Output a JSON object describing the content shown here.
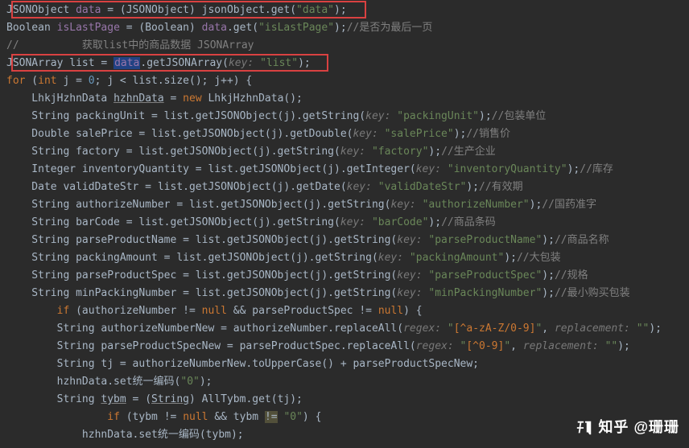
{
  "lines": {
    "l1": {
      "p1": "JSONObject ",
      "p2": "data",
      "p3": " = (JSONObject) jsonObject.get(",
      "p4": "\"data\"",
      "p5": ");"
    },
    "l2": {
      "p1": "Boolean ",
      "p2": "isLastPage",
      "p3": " = (Boolean) ",
      "p4": "data",
      "p5": ".get(",
      "p6": "\"isLastPage\"",
      "p7": ");",
      "p8": "//是否为最后一页"
    },
    "l3": {
      "p1": "//          获取list中的商品数据 JSONArray"
    },
    "l4": {
      "p1": "JSONArray list = ",
      "p2": "data",
      "p3": ".getJSONArray(",
      "p4": "key: ",
      "p5": "\"list\"",
      "p6": ");"
    },
    "l5": {
      "p1": "for",
      "p2": " (",
      "p3": "int",
      "p4": " j = ",
      "p5": "0",
      "p6": "; j < list.size(); j++) {"
    },
    "l6": {
      "p1": "    LhkjHzhnData ",
      "p2": "hzhnData",
      "p3": " = ",
      "p4": "new",
      "p5": " LhkjHzhnData();"
    },
    "l7": {
      "p1": "    String packingUnit = list.getJSONObject(j).getString(",
      "p2": "key: ",
      "p3": "\"packingUnit\"",
      "p4": ");",
      "p5": "//包装单位"
    },
    "l8": {
      "p1": "    Double salePrice = list.getJSONObject(j).getDouble(",
      "p2": "key: ",
      "p3": "\"salePrice\"",
      "p4": ");",
      "p5": "//销售价"
    },
    "l9": {
      "p1": "    String factory = list.getJSONObject(j).getString(",
      "p2": "key: ",
      "p3": "\"factory\"",
      "p4": ");",
      "p5": "//生产企业"
    },
    "l10": {
      "p1": "    Integer inventoryQuantity = list.getJSONObject(j).getInteger(",
      "p2": "key: ",
      "p3": "\"inventoryQuantity\"",
      "p4": ");",
      "p5": "//库存"
    },
    "l11": {
      "p1": "    Date validDateStr = list.getJSONObject(j).getDate(",
      "p2": "key: ",
      "p3": "\"validDateStr\"",
      "p4": ");",
      "p5": "//有效期"
    },
    "l12": {
      "p1": "    String authorizeNumber = list.getJSONObject(j).getString(",
      "p2": "key: ",
      "p3": "\"authorizeNumber\"",
      "p4": ");",
      "p5": "//国药准字"
    },
    "l13": {
      "p1": "    String barCode = list.getJSONObject(j).getString(",
      "p2": "key: ",
      "p3": "\"barCode\"",
      "p4": ");",
      "p5": "//商品条码"
    },
    "l14": {
      "p1": "    String parseProductName = list.getJSONObject(j).getString(",
      "p2": "key: ",
      "p3": "\"parseProductName\"",
      "p4": ");",
      "p5": "//商品名称"
    },
    "l15": {
      "p1": "    String packingAmount = list.getJSONObject(j).getString(",
      "p2": "key: ",
      "p3": "\"packingAmount\"",
      "p4": ");",
      "p5": "//大包装"
    },
    "l16": {
      "p1": "    String parseProductSpec = list.getJSONObject(j).getString(",
      "p2": "key: ",
      "p3": "\"parseProductSpec\"",
      "p4": ");",
      "p5": "//规格"
    },
    "l17": {
      "p1": "    String minPackingNumber = list.getJSONObject(j).getString(",
      "p2": "key: ",
      "p3": "\"minPackingNumber\"",
      "p4": ");",
      "p5": "//最小购买包装"
    },
    "l18": {
      "p1": "    if",
      "p2": " (authorizeNumber != ",
      "p3": "null",
      "p4": " && parseProductSpec != ",
      "p5": "null",
      "p6": ") {"
    },
    "l19": {
      "p1": "        String authorizeNumberNew = authorizeNumber.replaceAll(",
      "p2": "regex: ",
      "p3": "\"",
      "p4": "[^a-zA-Z/0-9]",
      "p5": "\"",
      "p6": ", ",
      "p7": "replacement: ",
      "p8": "\"\"",
      "p9": ");"
    },
    "l20": {
      "p1": "        String parseProductSpecNew = parseProductSpec.replaceAll(",
      "p2": "regex: ",
      "p3": "\"",
      "p4": "[^0-9]",
      "p5": "\"",
      "p6": ", ",
      "p7": "replacement: ",
      "p8": "\"\"",
      "p9": ");"
    },
    "l21": {
      "p1": "        String tj = authorizeNumberNew.toUpperCase() + parseProductSpecNew;"
    },
    "l22": {
      "p1": "        hzhnData.set统一编码(",
      "p2": "\"0\"",
      "p3": ");"
    },
    "l23": {
      "p1": "        String ",
      "p2": "tybm",
      "p3": " = (",
      "p4": "String",
      "p5": ") AllTybm.get(tj);"
    },
    "l24": {
      "p1": "        if",
      "p2": " (tybm != ",
      "p3": "null",
      "p4": " && tybm ",
      "p5": "!=",
      "p6": " ",
      "p7": "\"0\"",
      "p8": ") {"
    },
    "l25": {
      "p1": "            hzhnData.set统一编码(tybm);"
    }
  },
  "watermark": "知乎 @珊珊"
}
